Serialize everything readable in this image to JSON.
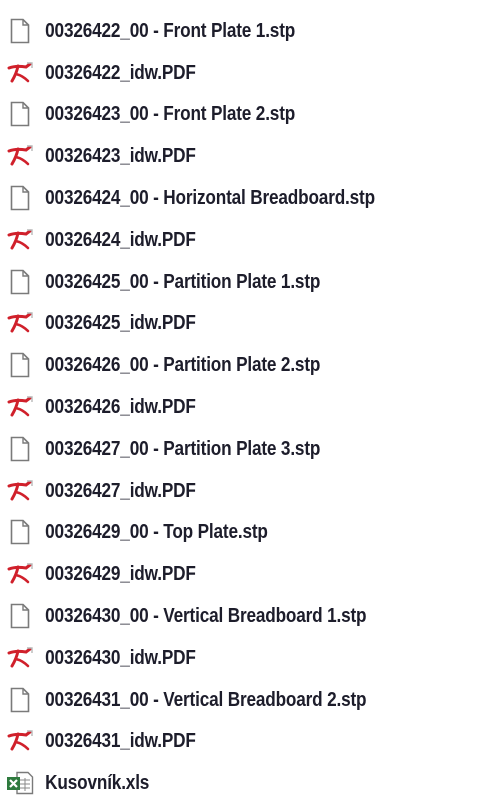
{
  "files": [
    {
      "name": "00326422_00 - Front Plate 1.stp",
      "icon": "generic-file-icon"
    },
    {
      "name": "00326422_idw.PDF",
      "icon": "pdf-icon"
    },
    {
      "name": "00326423_00 - Front Plate 2.stp",
      "icon": "generic-file-icon"
    },
    {
      "name": "00326423_idw.PDF",
      "icon": "pdf-icon"
    },
    {
      "name": "00326424_00 - Horizontal Breadboard.stp",
      "icon": "generic-file-icon"
    },
    {
      "name": "00326424_idw.PDF",
      "icon": "pdf-icon"
    },
    {
      "name": "00326425_00 - Partition Plate 1.stp",
      "icon": "generic-file-icon"
    },
    {
      "name": "00326425_idw.PDF",
      "icon": "pdf-icon"
    },
    {
      "name": "00326426_00 - Partition Plate 2.stp",
      "icon": "generic-file-icon"
    },
    {
      "name": "00326426_idw.PDF",
      "icon": "pdf-icon"
    },
    {
      "name": "00326427_00 - Partition Plate 3.stp",
      "icon": "generic-file-icon"
    },
    {
      "name": "00326427_idw.PDF",
      "icon": "pdf-icon"
    },
    {
      "name": "00326429_00 - Top Plate.stp",
      "icon": "generic-file-icon"
    },
    {
      "name": "00326429_idw.PDF",
      "icon": "pdf-icon"
    },
    {
      "name": "00326430_00 - Vertical Breadboard 1.stp",
      "icon": "generic-file-icon"
    },
    {
      "name": "00326430_idw.PDF",
      "icon": "pdf-icon"
    },
    {
      "name": "00326431_00 - Vertical Breadboard 2.stp",
      "icon": "generic-file-icon"
    },
    {
      "name": "00326431_idw.PDF",
      "icon": "pdf-icon"
    },
    {
      "name": "Kusovník.xls",
      "icon": "excel-file-icon"
    }
  ],
  "colors": {
    "text": "#1d1d2b",
    "pdf_red": "#d0202b",
    "excel_green": "#2e7a3e"
  }
}
